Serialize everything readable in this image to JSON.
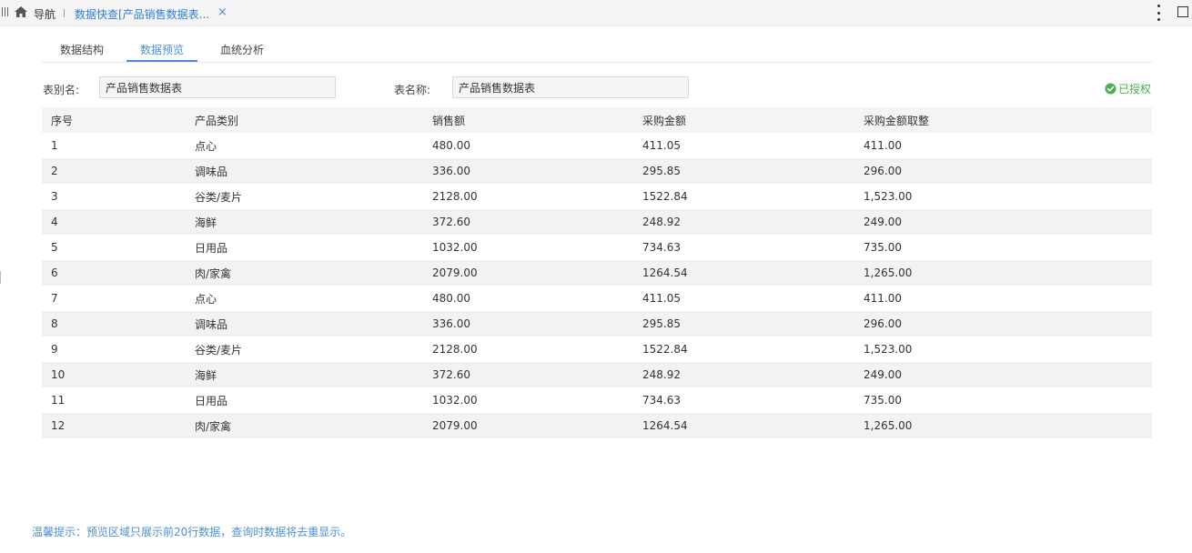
{
  "topbar": {
    "nav_label": "导航",
    "tab_title": "数据快查[产品销售数据表...",
    "close_glyph": "×",
    "tab_color": "#2f7fd3"
  },
  "subtabs": [
    {
      "label": "数据结构",
      "active": false
    },
    {
      "label": "数据预览",
      "active": true
    },
    {
      "label": "血统分析",
      "active": false
    }
  ],
  "fields": {
    "alias_label": "表别名:",
    "alias_value": "产品销售数据表",
    "name_label": "表名称:",
    "name_value": "产品销售数据表"
  },
  "status": {
    "label": "已授权",
    "color": "#4caf50",
    "icon": "check-circle-icon"
  },
  "table": {
    "columns": [
      "序号",
      "产品类别",
      "销售额",
      "采购金额",
      "采购金额取整"
    ],
    "rows": [
      [
        "1",
        "点心",
        "480.00",
        "411.05",
        "411.00"
      ],
      [
        "2",
        "调味品",
        "336.00",
        "295.85",
        "296.00"
      ],
      [
        "3",
        "谷类/麦片",
        "2128.00",
        "1522.84",
        "1,523.00"
      ],
      [
        "4",
        "海鲜",
        "372.60",
        "248.92",
        "249.00"
      ],
      [
        "5",
        "日用品",
        "1032.00",
        "734.63",
        "735.00"
      ],
      [
        "6",
        "肉/家禽",
        "2079.00",
        "1264.54",
        "1,265.00"
      ],
      [
        "7",
        "点心",
        "480.00",
        "411.05",
        "411.00"
      ],
      [
        "8",
        "调味品",
        "336.00",
        "295.85",
        "296.00"
      ],
      [
        "9",
        "谷类/麦片",
        "2128.00",
        "1522.84",
        "1,523.00"
      ],
      [
        "10",
        "海鲜",
        "372.60",
        "248.92",
        "249.00"
      ],
      [
        "11",
        "日用品",
        "1032.00",
        "734.63",
        "735.00"
      ],
      [
        "12",
        "肉/家禽",
        "2079.00",
        "1264.54",
        "1,265.00"
      ]
    ]
  },
  "footer": {
    "tip": "温馨提示：预览区域只展示前20行数据，查询时数据将去重显示。"
  },
  "colors": {
    "accent": "#4a8fd6",
    "row_stripe": "#f2f2f4"
  }
}
